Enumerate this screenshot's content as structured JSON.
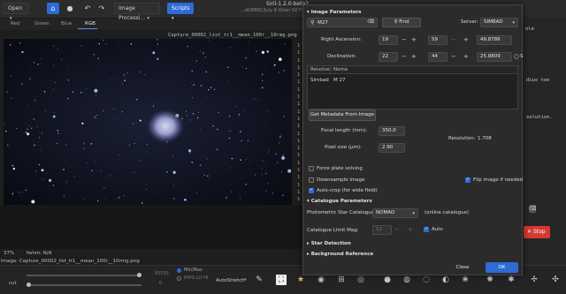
{
  "window": {
    "title": "Siril-1.2.0-beta2",
    "subtitle": "…s6/BBSC/July 8-Orion 50 Firstlight Dragsipu…"
  },
  "toolbar": {
    "open_label": "Open",
    "image_processing_label": "Image Processi…",
    "scripts_label": "Scripts"
  },
  "tabs": [
    {
      "label": "Red"
    },
    {
      "label": "Green"
    },
    {
      "label": "Blue"
    },
    {
      "label": "RGB"
    }
  ],
  "image": {
    "filename": "Capture_00002_list_tr1__mean_100r__10rmg.png"
  },
  "status": {
    "zoom": "37%",
    "fwhm": "fwhm: N/A",
    "image_line": "Image: Capture_00002_list_tr1__mean_100r__10rmg.png"
  },
  "bottom_bar": {
    "cut_label": "cut",
    "low_value": "0",
    "high_value": "65535",
    "mode_options": [
      "Min/Max",
      "MIPS-LO-HI"
    ],
    "stretch_label": "AutoStretch"
  },
  "console": {
    "line_markers": [
      "1",
      "1",
      "1",
      "1",
      "1",
      "1",
      "1",
      "1",
      "1",
      "1",
      "1",
      "1",
      "1",
      "1",
      "1",
      "1",
      "1",
      "1",
      "1",
      "1",
      "1",
      "1"
    ],
    "right_fragments": [
      "dius too",
      "solution."
    ],
    "tab_label": "ole",
    "stop_label": "Stop"
  },
  "dialog": {
    "image_params_header": "Image Parameters",
    "search_value": "M27",
    "find_label": "Find",
    "server_label": "Server:",
    "server_value": "SIMBAD",
    "ra_label": "Right Ascension:",
    "ra": {
      "h": "19",
      "m": "59",
      "s": "49.8786"
    },
    "dec_label": "Declination:",
    "dec": {
      "d": "22",
      "m": "44",
      "s": "25.8809"
    },
    "dec_sign": "S",
    "table_headers": [
      "Resolver",
      "Name"
    ],
    "table_rows": [
      {
        "resolver": "Simbad",
        "name": "M 27"
      }
    ],
    "get_metadata_label": "Get Metadata From Image",
    "focal_label": "Focal length (mm):",
    "focal_value": "350.0",
    "pixel_label": "Pixel size (μm):",
    "pixel_value": "2.90",
    "resolution_label": "Resolution:",
    "resolution_value": "1.708",
    "force_plate_label": "Force plate solving",
    "downsample_label": "Downsample image",
    "flip_label": "Flip image if needed",
    "autocrop_label": "Auto-crop (for wide field)",
    "catalogue_header": "Catalogue Parameters",
    "photometric_label": "Photometric Star Catalogue:",
    "photometric_value": "NOMAD",
    "online_label": "(online catalogue)",
    "limit_label": "Catalogue Limit Mag:",
    "limit_value": "12",
    "auto_label": "Auto",
    "star_detection_header": "Star Detection",
    "background_header": "Background Reference",
    "close_label": "Close",
    "ok_label": "OK"
  },
  "colors": {
    "accent": "#2e6bd6",
    "stop": "#d43a2f",
    "background": "#1e1e1e"
  }
}
